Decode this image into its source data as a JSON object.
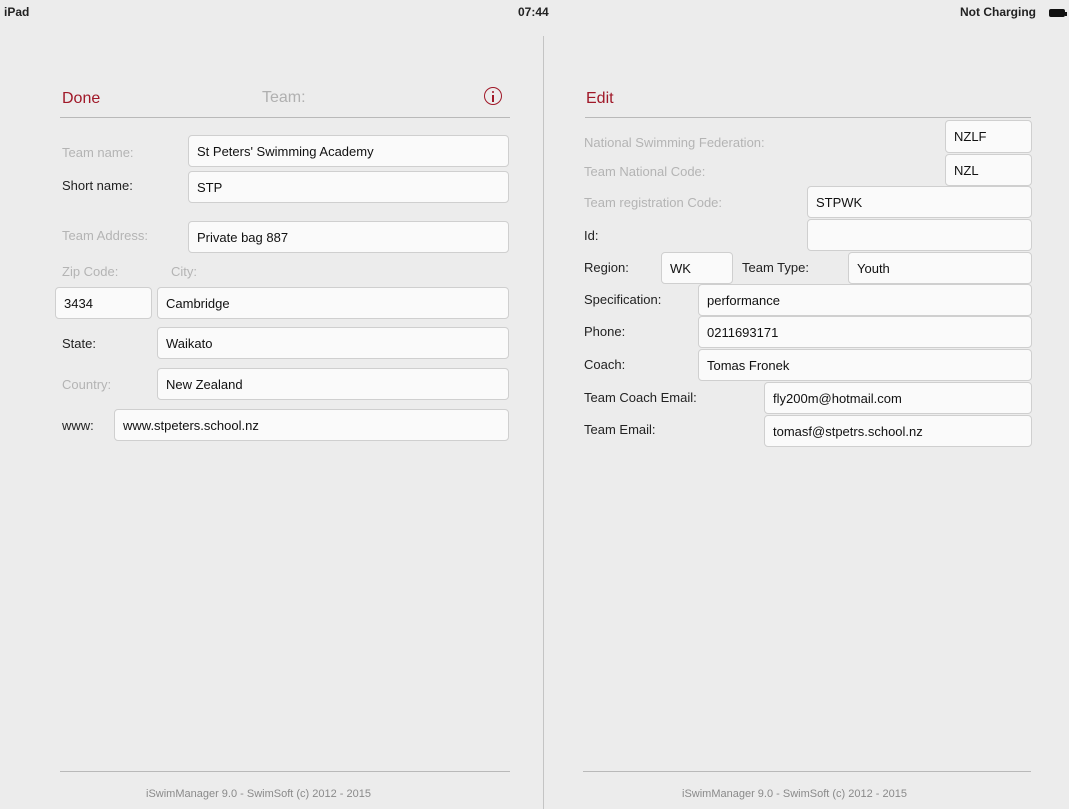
{
  "status_bar": {
    "device": "iPad",
    "time": "07:44",
    "battery": "Not Charging"
  },
  "left": {
    "done_label": "Done",
    "title": "Team:",
    "fields": {
      "team_name": {
        "label": "Team name:",
        "value": "St Peters' Swimming Academy"
      },
      "short_name": {
        "label": "Short name:",
        "value": "STP"
      },
      "team_address": {
        "label": "Team Address:",
        "value": "Private bag 887"
      },
      "zip_code": {
        "label": "Zip Code:",
        "value": "3434"
      },
      "city": {
        "label": "City:",
        "value": "Cambridge"
      },
      "state": {
        "label": "State:",
        "value": "Waikato"
      },
      "country": {
        "label": "Country:",
        "value": "New Zealand"
      },
      "www": {
        "label": "www:",
        "value": "www.stpeters.school.nz"
      }
    },
    "footer": "iSwimManager 9.0 - SwimSoft (c) 2012 - 2015"
  },
  "right": {
    "edit_label": "Edit",
    "fields": {
      "federation": {
        "label": "National Swimming Federation:",
        "value": "NZLF"
      },
      "national_code": {
        "label": "Team National Code:",
        "value": "NZL"
      },
      "registration_code": {
        "label": "Team registration Code:",
        "value": "STPWK"
      },
      "id": {
        "label": "Id:",
        "value": ""
      },
      "region": {
        "label": "Region:",
        "value": "WK"
      },
      "team_type": {
        "label": "Team Type:",
        "value": "Youth"
      },
      "specification": {
        "label": "Specification:",
        "value": "performance"
      },
      "phone": {
        "label": "Phone:",
        "value": "0211693171"
      },
      "coach": {
        "label": "Coach:",
        "value": "Tomas Fronek"
      },
      "coach_email": {
        "label": "Team Coach Email:",
        "value": "fly200m@hotmail.com"
      },
      "team_email": {
        "label": "Team Email:",
        "value": "tomasf@stpetrs.school.nz"
      }
    },
    "footer": "iSwimManager 9.0 - SwimSoft (c) 2012 - 2015"
  },
  "colors": {
    "accent": "#a01828",
    "muted_label": "#b4b4b4",
    "background": "#ececec"
  }
}
